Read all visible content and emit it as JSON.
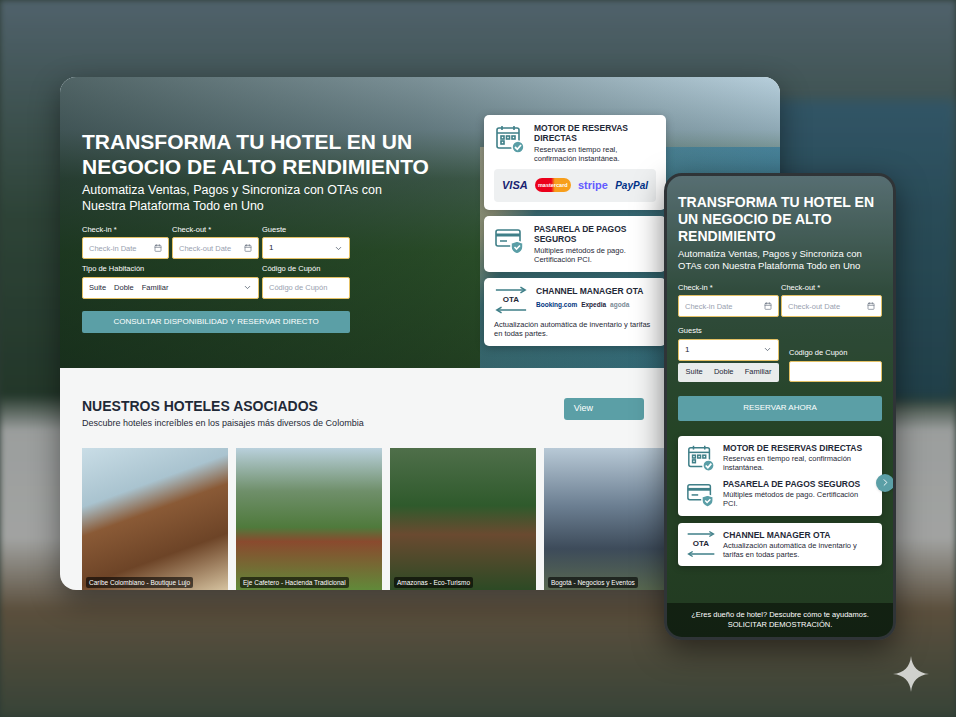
{
  "desktop": {
    "hero": {
      "title": "TRANSFORMA TU HOTEL EN UN NEGOCIO DE ALTO RENDIMIENTO",
      "subtitle": "Automatiza Ventas, Pagos y Sincroniza con OTAs con Nuestra Plataforma Todo en Uno",
      "checkin": {
        "label": "Check-in *",
        "placeholder": "Check-in Date"
      },
      "checkout": {
        "label": "Check-out *",
        "placeholder": "Check-out Date"
      },
      "guests": {
        "label": "Gueste",
        "value": "1"
      },
      "room": {
        "label": "Tipo de Habitación",
        "options": [
          "Suite",
          "Doble",
          "Familiar"
        ]
      },
      "coupon": {
        "label": "Código de Cupón",
        "placeholder": "Código de Cupón"
      },
      "button": "CONSULTAR DISPONIBILIDAD Y RESERVAR DIRECTO"
    },
    "features": [
      {
        "title": "MOTOR DE RESERVAS DIRECTAS",
        "text": "Reservas en tiempo real, confirmación instantánea.",
        "logos": [
          "VISA",
          "mastercard",
          "stripe",
          "PayPal"
        ]
      },
      {
        "title": "PASARELA DE PAGOS SEGUROS",
        "text": "Múltiples métodos de pago. Certificación PCI.",
        "logos": []
      },
      {
        "title": "CHANNEL MANAGER OTA",
        "text": "Actualización automática de inventario y tarifas en todas partes.",
        "logos": [
          "Booking.com",
          "Expedia",
          "agoda"
        ],
        "iconText": "OTA"
      }
    ],
    "hotels": {
      "title": "NUESTROS HOTELES ASOCIADOS",
      "subtitle": "Descubre hoteles increíbles en los paisajes más diversos de Colombia",
      "button": "View",
      "items": [
        {
          "caption": "Caribe Colombiano - Boutique Lujo"
        },
        {
          "caption": "Eje Cafetero - Hacienda Tradicional"
        },
        {
          "caption": "Amazonas - Eco-Turismo"
        },
        {
          "caption": "Bogotá - Negocios y Eventos"
        }
      ]
    }
  },
  "mobile": {
    "title": "TRANSFORMA TU HOTEL EN UN NEGOCIO DE ALTO RENDIMIENTO",
    "subtitle": "Automatiza Ventas, Pagos y Sincroniza con OTAs con Nuestra Plataforma Todo en Uno",
    "checkin": {
      "label": "Check-in *",
      "placeholder": "Check-in Date"
    },
    "checkout": {
      "label": "Check-out *",
      "placeholder": "Check-out Date"
    },
    "guests": {
      "label": "Guests",
      "value": "1"
    },
    "room": {
      "options": [
        "Suite",
        "Doble",
        "Familiar"
      ]
    },
    "coupon": {
      "label": "Código de Cupón"
    },
    "button": "RESERVAR AHORA",
    "featureCards": [
      {
        "items": [
          {
            "title": "MOTOR DE RESERVAS DIRECTAS",
            "text": "Reservas en tiempo real, confirmación instantánea."
          },
          {
            "title": "PASARELA DE PAGOS SEGUROS",
            "text": "Múltiples métodos de pago. Certificación PCI."
          }
        ]
      },
      {
        "items": [
          {
            "title": "CHANNEL MANAGER OTA",
            "text": "Actualización automática de inventario y tarifas en todas partes.",
            "iconText": "OTA"
          }
        ]
      }
    ],
    "footer": {
      "question": "¿Eres dueño de hotel? Descubre cómo te ayudamos.",
      "link": "SOLICITAR DEMOSTRACIÓN."
    }
  }
}
